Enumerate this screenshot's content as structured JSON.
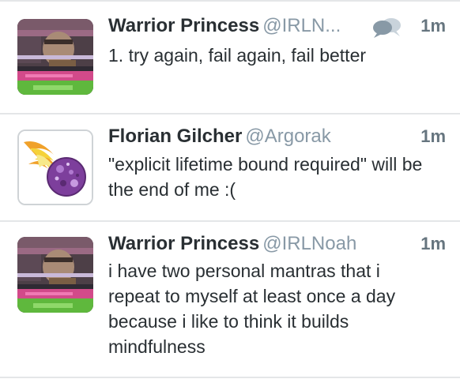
{
  "tweets": [
    {
      "display_name": "Warrior Princess",
      "handle": "@IRLN...",
      "time": "1m",
      "text": "1. try again, fail again, fail better",
      "avatar": "glitch-portrait-avatar",
      "has_conversation_icon": true
    },
    {
      "display_name": "Florian Gilcher",
      "handle": "@Argorak",
      "time": "1m",
      "text": "\"explicit lifetime bound required\" will be the end of me :(",
      "avatar": "flaming-planet-avatar",
      "has_conversation_icon": false
    },
    {
      "display_name": "Warrior Princess",
      "handle": "@IRLNoah",
      "time": "1m",
      "text": "i have two personal mantras that i repeat to myself at least once a day because i like to think it builds mindfulness",
      "avatar": "glitch-portrait-avatar",
      "has_conversation_icon": false
    }
  ],
  "colors": {
    "name": "#292f33",
    "handle": "#8899a6",
    "timestamp": "#66757f",
    "divider": "#e4e6e8"
  }
}
